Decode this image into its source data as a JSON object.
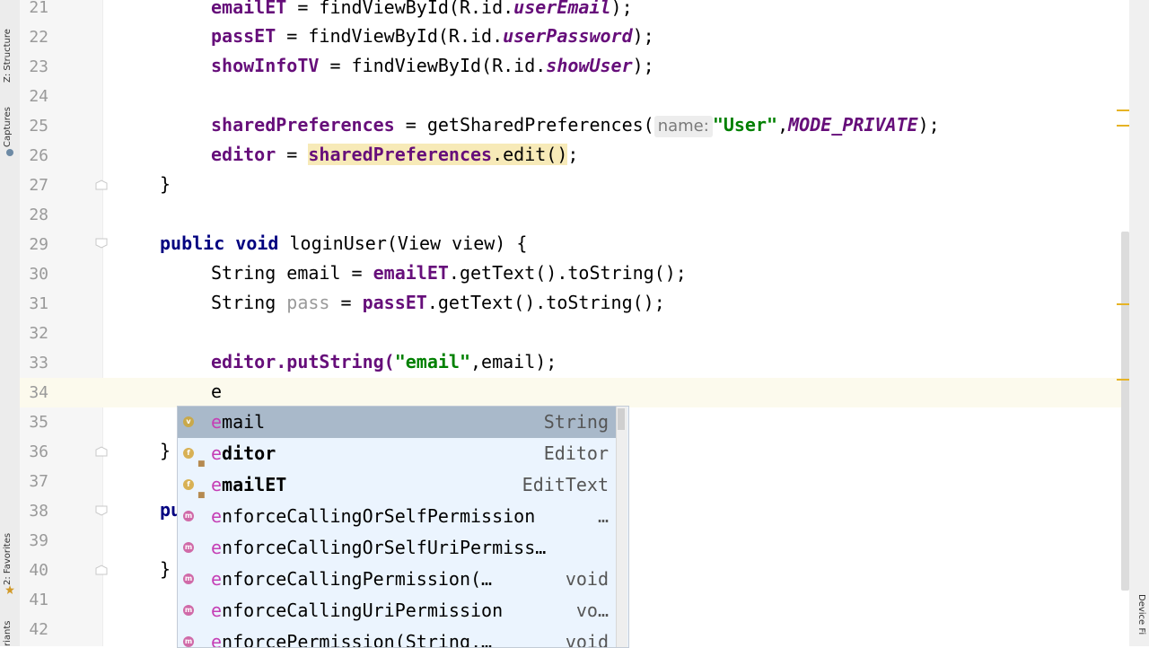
{
  "sidebar": {
    "structure": "Z: Structure",
    "captures": "Captures",
    "favorites": "2: Favorites",
    "variants": "riants"
  },
  "right_panel": {
    "device_file": "Device Fi"
  },
  "lines": [
    {
      "n": "21"
    },
    {
      "n": "22"
    },
    {
      "n": "23"
    },
    {
      "n": "24"
    },
    {
      "n": "25"
    },
    {
      "n": "26"
    },
    {
      "n": "27"
    },
    {
      "n": "28"
    },
    {
      "n": "29"
    },
    {
      "n": "30"
    },
    {
      "n": "31"
    },
    {
      "n": "32"
    },
    {
      "n": "33"
    },
    {
      "n": "34"
    },
    {
      "n": "35"
    },
    {
      "n": "36"
    },
    {
      "n": "37"
    },
    {
      "n": "38"
    },
    {
      "n": "39"
    },
    {
      "n": "40"
    },
    {
      "n": "41"
    },
    {
      "n": "42"
    }
  ],
  "code": {
    "l21": {
      "a": "emailET",
      "b": " = findViewById(R.id.",
      "c": "userEmail",
      "d": ");"
    },
    "l22": {
      "a": "passET",
      "b": " = findViewById(R.id.",
      "c": "userPassword",
      "d": ");"
    },
    "l23": {
      "a": "showInfoTV",
      "b": " = findViewById(R.id.",
      "c": "showUser",
      "d": ");"
    },
    "l25": {
      "a": "sharedPreferences",
      "b": " = getSharedPreferences(",
      "hint": "name:",
      "s": "\"User\"",
      "c": ",",
      "d": "MODE_PRIVATE",
      "e": ");"
    },
    "l26": {
      "a": "editor",
      "b": " = ",
      "c": "sharedPreferences",
      "d": ".edit()",
      "e": ";"
    },
    "l27": {
      "a": "}"
    },
    "l29": {
      "a": "public void ",
      "b": "loginUser(View view) {"
    },
    "l30": {
      "a": "String email = ",
      "b": "emailET",
      ".": "",
      "c": ".getText().toString();"
    },
    "l31": {
      "a": "String ",
      "b": "pass",
      "c": " = ",
      "d": "passET",
      "e": ".getText().toString();"
    },
    "l33": {
      "a": "editor.putString(",
      "b": "\"email\"",
      "c": ",email);"
    },
    "l34": {
      "a": "e"
    },
    "l36": {
      "a": "}"
    },
    "l38": {
      "a": "pu"
    },
    "l40": {
      "a": "}"
    }
  },
  "autocomplete": {
    "items": [
      {
        "m": "e",
        "rest": "mail",
        "type": "String",
        "icon": "v",
        "selected": true
      },
      {
        "m": "e",
        "rest": "ditor",
        "type": "Editor",
        "icon": "f",
        "lock": true
      },
      {
        "m": "e",
        "rest": "mailET",
        "type": "EditText",
        "icon": "f",
        "lock": true
      },
      {
        "m": "e",
        "rest": "nforceCallingOrSelfPermission",
        "type": "…",
        "icon": "m"
      },
      {
        "m": "e",
        "rest": "nforceCallingOrSelfUriPermiss…",
        "type": "",
        "icon": "m"
      },
      {
        "m": "e",
        "rest": "nforceCallingPermission(…",
        "type": "void",
        "icon": "m"
      },
      {
        "m": "e",
        "rest": "nforceCallingUriPermission",
        "type": "vo…",
        "icon": "m"
      },
      {
        "m": "e",
        "rest": "nforcePermission(String,…",
        "type": "void",
        "icon": "m"
      }
    ]
  },
  "colors": {
    "keyword": "#000080",
    "field": "#660e7a",
    "string": "#008000",
    "current_line": "#fcfaed",
    "popup": "#ebf4fe",
    "selection": "#a9b9ca"
  }
}
